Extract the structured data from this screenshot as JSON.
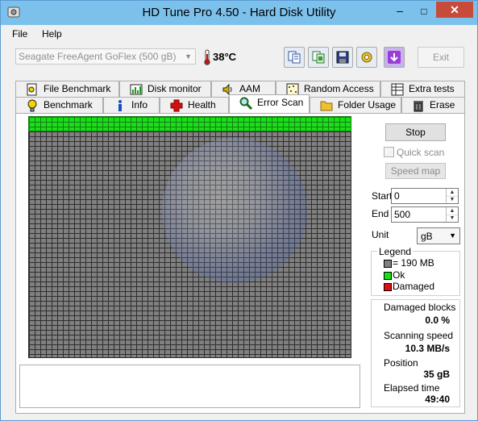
{
  "window": {
    "title": "HD Tune Pro 4.50 - Hard Disk Utility",
    "minimize_glyph": "–",
    "maximize_glyph": "□",
    "close_glyph": "✕"
  },
  "menu": {
    "file": "File",
    "help": "Help"
  },
  "toolbar": {
    "drive": "Seagate FreeAgent GoFlex (500 gB)",
    "temperature": "38°C",
    "exit_label": "Exit",
    "icons": [
      "copy-text-icon",
      "copy-screenshot-icon",
      "save-icon",
      "options-icon",
      "download-icon"
    ]
  },
  "tabs_top": [
    {
      "label": "File Benchmark",
      "icon": "file-benchmark-icon"
    },
    {
      "label": "Disk monitor",
      "icon": "disk-monitor-icon"
    },
    {
      "label": "AAM",
      "icon": "speaker-icon"
    },
    {
      "label": "Random Access",
      "icon": "random-access-icon"
    },
    {
      "label": "Extra tests",
      "icon": "extra-tests-icon"
    }
  ],
  "tabs_bottom": [
    {
      "label": "Benchmark",
      "icon": "benchmark-bulb-icon"
    },
    {
      "label": "Info",
      "icon": "info-icon"
    },
    {
      "label": "Health",
      "icon": "health-cross-icon"
    },
    {
      "label": "Error Scan",
      "icon": "magnifier-icon",
      "active": true
    },
    {
      "label": "Folder Usage",
      "icon": "folder-icon"
    },
    {
      "label": "Erase",
      "icon": "trash-icon"
    }
  ],
  "controls": {
    "stop_label": "Stop",
    "quick_scan_label": "Quick scan",
    "speed_map_label": "Speed map",
    "start_label": "Start",
    "start_value": "0",
    "end_label": "End",
    "end_value": "500",
    "unit_label": "Unit",
    "unit_value": "gB"
  },
  "legend": {
    "title": "Legend",
    "block": "= 190 MB",
    "ok": "Ok",
    "damaged": "Damaged",
    "colors": {
      "block": "#808080",
      "ok": "#16e016",
      "damaged": "#e01010"
    }
  },
  "stats": {
    "damaged_blocks_label": "Damaged blocks",
    "damaged_blocks_value": "0.0 %",
    "scanning_speed_label": "Scanning speed",
    "scanning_speed_value": "10.3 MB/s",
    "position_label": "Position",
    "position_value": "35 gB",
    "elapsed_label": "Elapsed time",
    "elapsed_value": "49:40"
  }
}
